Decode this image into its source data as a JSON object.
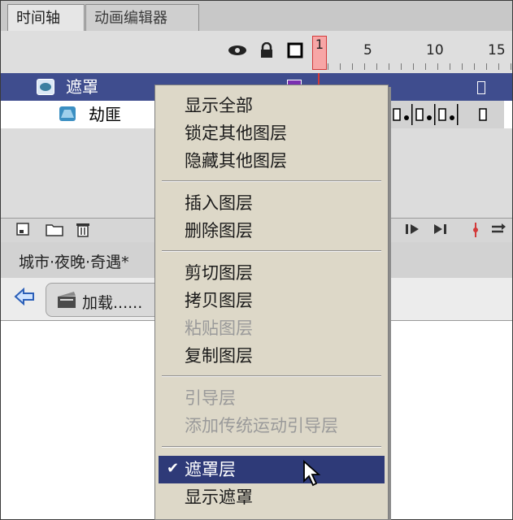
{
  "tabs": [
    "时间轴",
    "动画编辑器"
  ],
  "header": {
    "ruler": [
      "1",
      "5",
      "10",
      "15"
    ]
  },
  "layers": [
    {
      "name": "遮罩",
      "selected": true
    },
    {
      "name": "劫匪",
      "selected": false
    }
  ],
  "document": {
    "tab_title": "城市·夜晚·奇遇*",
    "scene_label": "加载......"
  },
  "context_menu": {
    "group1": [
      "显示全部",
      "锁定其他图层",
      "隐藏其他图层"
    ],
    "group2": [
      "插入图层",
      "删除图层"
    ],
    "group3": [
      "剪切图层",
      "拷贝图层",
      "粘贴图层",
      "复制图层"
    ],
    "group4": [
      "引导层",
      "添加传统运动引导层"
    ],
    "group5": [
      "遮罩层",
      "显示遮罩"
    ],
    "checked_item": "遮罩层",
    "check_mark": "✔"
  },
  "colors": {
    "selection": "#3f4d8e",
    "menu_bg": "#ddd8c8",
    "menu_highlight": "#2e3a78",
    "playhead": "#d23a3a"
  },
  "icons": [
    "eye-icon",
    "lock-icon",
    "outline-icon",
    "new-layer-icon",
    "new-folder-icon",
    "delete-layer-icon",
    "back-arrow-icon",
    "scene-icon",
    "mouse-cursor-icon"
  ]
}
